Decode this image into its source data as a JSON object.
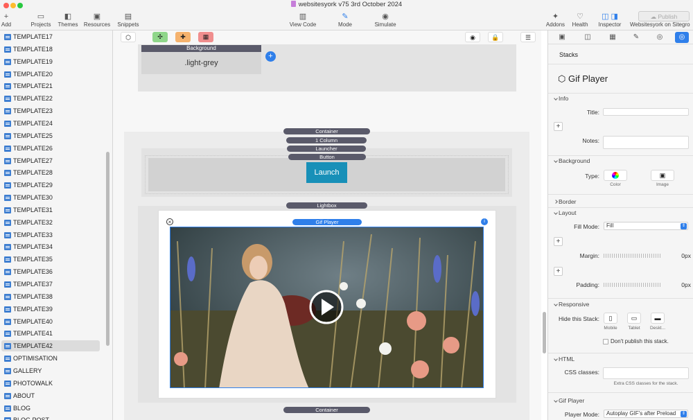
{
  "window": {
    "title": "websitesyork v75 3rd October 2024"
  },
  "toolbar": {
    "add": "Add",
    "projects": "Projects",
    "themes": "Themes",
    "resources": "Resources",
    "snippets": "Snippets",
    "view_code": "View Code",
    "mode": "Mode",
    "simulate": "Simulate",
    "addons": "Addons",
    "health": "Health",
    "inspector": "Inspector",
    "site": "Websitesyork on Sitegro",
    "publish": "Publish"
  },
  "sidebar": {
    "items": [
      {
        "label": "TEMPLATE17",
        "selected": false
      },
      {
        "label": "TEMPLATE18",
        "selected": false
      },
      {
        "label": "TEMPLATE19",
        "selected": false
      },
      {
        "label": "TEMPLATE20",
        "selected": false
      },
      {
        "label": "TEMPLATE21",
        "selected": false
      },
      {
        "label": "TEMPLATE22",
        "selected": false
      },
      {
        "label": "TEMPLATE23",
        "selected": false
      },
      {
        "label": "TEMPLATE24",
        "selected": false
      },
      {
        "label": "TEMPLATE25",
        "selected": false
      },
      {
        "label": "TEMPLATE26",
        "selected": false
      },
      {
        "label": "TEMPLATE27",
        "selected": false
      },
      {
        "label": "TEMPLATE28",
        "selected": false
      },
      {
        "label": "TEMPLATE29",
        "selected": false
      },
      {
        "label": "TEMPLATE30",
        "selected": false
      },
      {
        "label": "TEMPLATE31",
        "selected": false
      },
      {
        "label": "TEMPLATE32",
        "selected": false
      },
      {
        "label": "TEMPLATE33",
        "selected": false
      },
      {
        "label": "TEMPLATE34",
        "selected": false
      },
      {
        "label": "TEMPLATE35",
        "selected": false
      },
      {
        "label": "TEMPLATE36",
        "selected": false
      },
      {
        "label": "TEMPLATE37",
        "selected": false
      },
      {
        "label": "TEMPLATE38",
        "selected": false
      },
      {
        "label": "TEMPLATE39",
        "selected": false
      },
      {
        "label": "TEMPLATE40",
        "selected": false
      },
      {
        "label": "TEMPLATE41",
        "selected": false
      },
      {
        "label": "TEMPLATE42",
        "selected": true
      },
      {
        "label": "OPTIMISATION",
        "selected": false
      },
      {
        "label": "GALLERY",
        "selected": false
      },
      {
        "label": "PHOTOWALK",
        "selected": false
      },
      {
        "label": "ABOUT",
        "selected": false
      },
      {
        "label": "BLOG",
        "selected": false
      },
      {
        "label": "BLOG POST",
        "selected": false
      }
    ]
  },
  "canvas": {
    "background_tag": "Background",
    "background_box": ".light-grey",
    "tags": {
      "container": "Container",
      "one_column": "1 Column",
      "launcher": "Launcher",
      "button": "Button",
      "lightbox": "Lightbox",
      "gif_player": "Gif Player",
      "container_bottom": "Container"
    },
    "launch_button": "Launch"
  },
  "inspector": {
    "header": "Stacks",
    "stack_name": "Gif Player",
    "sections": {
      "info": "Info",
      "background": "Background",
      "border": "Border",
      "layout": "Layout",
      "responsive": "Responsive",
      "html": "HTML",
      "gif_player": "Gif Player"
    },
    "title_label": "Title:",
    "notes_label": "Notes:",
    "type_label": "Type:",
    "type_color": "Color",
    "type_image": "Image",
    "fill_mode_label": "Fill Mode:",
    "fill_mode_value": "Fill",
    "margin_label": "Margin:",
    "margin_value": "0px",
    "padding_label": "Padding:",
    "padding_value": "0px",
    "hide_label": "Hide this Stack:",
    "hide_mobile": "Mobile",
    "hide_tablet": "Tablet",
    "hide_desktop": "Deskt...",
    "dont_publish": "Don't publish this stack.",
    "css_label": "CSS classes:",
    "css_hint": "Extra CSS classes for the stack.",
    "player_mode_label": "Player Mode:",
    "player_mode_value": "Autoplay GIF's after Preload"
  },
  "colors": {
    "accent": "#2f7fea",
    "launch": "#1890b8",
    "tag": "#5a5a6a"
  }
}
